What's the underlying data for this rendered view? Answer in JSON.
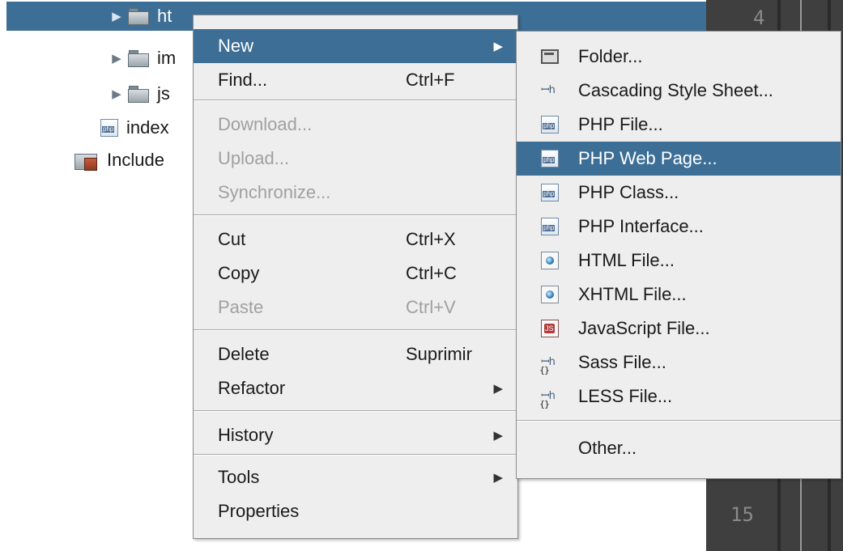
{
  "tree": {
    "items": [
      {
        "label": "ht",
        "type": "folder",
        "selected": true
      },
      {
        "label": "im",
        "type": "folder"
      },
      {
        "label": "js",
        "type": "folder"
      },
      {
        "label": "index",
        "type": "php-file"
      },
      {
        "label": "Include",
        "type": "include-path"
      }
    ]
  },
  "editor": {
    "line_numbers": [
      "4",
      "15"
    ]
  },
  "context_menu": {
    "new": {
      "label": "New"
    },
    "find": {
      "label": "Find...",
      "shortcut": "Ctrl+F"
    },
    "download": {
      "label": "Download..."
    },
    "upload": {
      "label": "Upload..."
    },
    "synchronize": {
      "label": "Synchronize..."
    },
    "cut": {
      "label": "Cut",
      "shortcut": "Ctrl+X"
    },
    "copy": {
      "label": "Copy",
      "shortcut": "Ctrl+C"
    },
    "paste": {
      "label": "Paste",
      "shortcut": "Ctrl+V"
    },
    "delete": {
      "label": "Delete",
      "shortcut": "Suprimir"
    },
    "refactor": {
      "label": "Refactor"
    },
    "history": {
      "label": "History"
    },
    "tools": {
      "label": "Tools"
    },
    "properties": {
      "label": "Properties"
    },
    "submenu_arrow": "▶"
  },
  "new_submenu": {
    "folder": {
      "label": "Folder...",
      "icon": "folder-icon"
    },
    "css": {
      "label": "Cascading Style Sheet...",
      "icon": "css-icon"
    },
    "php_file": {
      "label": "PHP File...",
      "icon": "php-file-icon"
    },
    "php_web_page": {
      "label": "PHP Web Page...",
      "icon": "php-file-icon",
      "highlighted": true
    },
    "php_class": {
      "label": "PHP Class...",
      "icon": "php-file-icon"
    },
    "php_interface": {
      "label": "PHP Interface...",
      "icon": "php-file-icon"
    },
    "html_file": {
      "label": "HTML File...",
      "icon": "html-file-icon"
    },
    "xhtml_file": {
      "label": "XHTML File...",
      "icon": "html-file-icon"
    },
    "javascript_file": {
      "label": "JavaScript File...",
      "icon": "javascript-file-icon"
    },
    "sass_file": {
      "label": "Sass File...",
      "icon": "sass-file-icon"
    },
    "less_file": {
      "label": "LESS File...",
      "icon": "less-file-icon"
    },
    "other": {
      "label": "Other..."
    }
  },
  "colors": {
    "selection": "#3c6e96",
    "menu_background": "#eeeeee",
    "disabled_text": "#a0a0a0",
    "editor_background": "#3f3f3f"
  }
}
